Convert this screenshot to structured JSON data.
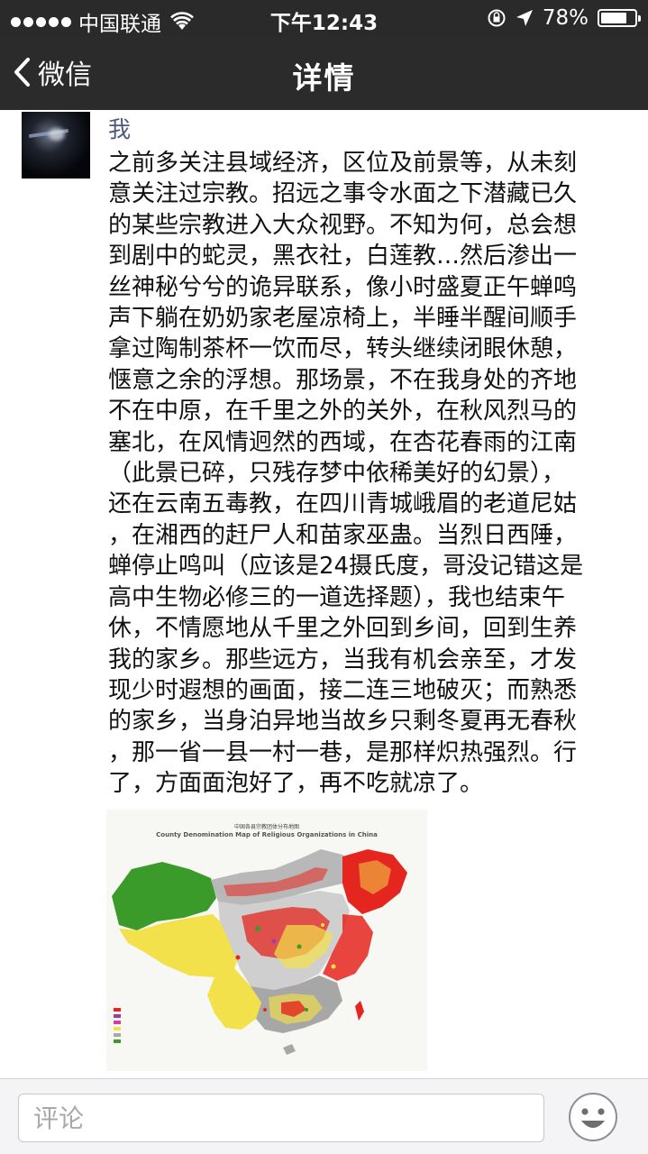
{
  "status_bar": {
    "carrier": "中国联通",
    "time": "下午12:43",
    "battery": "78%",
    "battery_level": 0.78
  },
  "nav": {
    "back_label": "微信",
    "title": "详情"
  },
  "post": {
    "author": "我",
    "text_lines": [
      "之前多关注县域经济，区位及前景等，从未刻",
      "意关注过宗教。招远之事令水面之下潜藏已久",
      "的某些宗教进入大众视野。不知为何，总会想",
      "到剧中的蛇灵，黑衣社，白莲教…然后渗出一",
      "丝神秘兮兮的诡异联系，像小时盛夏正午蝉鸣",
      "声下躺在奶奶家老屋凉椅上，半睡半醒间顺手",
      "拿过陶制茶杯一饮而尽，转头继续闭眼休憩，",
      "惬意之余的浮想。那场景，不在我身处的齐地",
      "不在中原，在千里之外的关外，在秋风烈马的",
      "塞北，在风情迥然的西域，在杏花春雨的江南",
      "（此景已碎，只残存梦中依稀美好的幻景），",
      "还在云南五毒教，在四川青城峨眉的老道尼姑",
      "，在湘西的赶尸人和苗家巫蛊。当烈日西陲，",
      "蝉停止鸣叫（应该是24摄氏度，哥没记错这是",
      "高中生物必修三的一道选择题），我也结束午",
      "休，不情愿地从千里之外回到乡间，回到生养",
      "我的家乡。那些远方，当我有机会亲至，才发",
      "现少时遐想的画面，接二连三地破灭；而熟悉",
      "的家乡，当身泊异地当故乡只剩冬夏再无春秋",
      "，那一省一县一村一巷，是那样炽热强烈。行",
      "了，方面面泡好了，再不吃就凉了。"
    ],
    "image": {
      "title_cn": "中国各县宗教团体分布地图",
      "title_en": "County Denomination Map of Religious Organizations in China"
    }
  },
  "comment": {
    "placeholder": "评论"
  },
  "icons": {
    "back": "chevron-left-icon",
    "emoji": "smiley-icon",
    "wifi": "wifi-icon",
    "lock": "rotation-lock-icon",
    "location": "location-arrow-icon",
    "battery": "battery-icon"
  },
  "colors": {
    "nav_bg": "#2b2b2b",
    "author": "#4a5a7d",
    "map_green": "#3a9b2a",
    "map_yellow": "#f2e14a",
    "map_red": "#e5261f",
    "map_grey": "#a7a7a7"
  }
}
